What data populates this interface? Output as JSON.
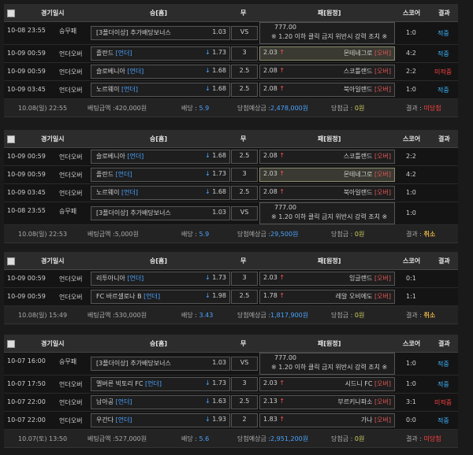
{
  "header": {
    "col_date": "경기일시",
    "col_type": "",
    "col_home": "승[홈]",
    "col_draw": "무",
    "col_away": "패[원정]",
    "col_score": "스코어",
    "col_result": "결과"
  },
  "labels": {
    "bet_amount": "베팅금액 :",
    "odds": "배당 :",
    "expected": "당첨예상금 :",
    "won": "당첨금 :",
    "result": "결과 :"
  },
  "special_text_1": "777.00",
  "special_text_2": "※ 1.20 이하 클릭 금지 위반시 강력 조치 ※",
  "bonus_label": "[3폴더이상] 추가배당보너스",
  "blocks": [
    {
      "rows": [
        {
          "date": "10-08 23:55",
          "type": "승무패",
          "home": "[3폴더이상] 추가배당보너스",
          "hodd": "1.03",
          "draw": "VS",
          "away": "",
          "score": "1:0",
          "result": "적중",
          "special": true
        },
        {
          "date": "10-09 00:59",
          "type": "언더오버",
          "home": "졸란드 [언더]",
          "hodd": "1.73",
          "draw": "3",
          "aodd": "2.03",
          "away": "몬테네그로 [오버]",
          "score": "4:2",
          "result": "적중"
        },
        {
          "date": "10-09 00:59",
          "type": "언더오버",
          "home": "슬로베니아 [언더]",
          "hodd": "1.68",
          "draw": "2.5",
          "aodd": "2.08",
          "away": "스코틀랜드 [오버]",
          "score": "2:2",
          "result": "미적중"
        },
        {
          "date": "10-09 03:45",
          "type": "언더오버",
          "home": "노르웨이 [언더]",
          "hodd": "1.68",
          "draw": "2.5",
          "aodd": "2.08",
          "away": "북아일랜드 [오버]",
          "score": "1:0",
          "result": "적중"
        }
      ],
      "foot": {
        "date": "10.08(일) 22:55",
        "bet": "420,000원",
        "odds": "5.9",
        "expected": "2,478,000원",
        "won": "0원",
        "result": "미당첨"
      }
    },
    {
      "rows": [
        {
          "date": "10-09 00:59",
          "type": "언더오버",
          "home": "슬로베니아 [언더]",
          "hodd": "1.68",
          "draw": "2.5",
          "aodd": "2.08",
          "away": "스코틀랜드 [오버]",
          "score": "2:2",
          "result": ""
        },
        {
          "date": "10-09 00:59",
          "type": "언더오버",
          "home": "졸란드 [언더]",
          "hodd": "1.73",
          "draw": "3",
          "aodd": "2.03",
          "away": "몬테네그로 [오버]",
          "score": "4:2",
          "result": ""
        },
        {
          "date": "10-09 03:45",
          "type": "언더오버",
          "home": "노르웨이 [언더]",
          "hodd": "1.68",
          "draw": "2.5",
          "aodd": "2.08",
          "away": "북아일랜드 [오버]",
          "score": "1:0",
          "result": ""
        },
        {
          "date": "10-08 23:55",
          "type": "승무패",
          "home": "[3폴더이상] 추가배당보너스",
          "hodd": "1.03",
          "draw": "VS",
          "away": "",
          "score": "1:0",
          "result": "",
          "special": true
        }
      ],
      "foot": {
        "date": "10.08(일) 22:53",
        "bet": "5,000원",
        "odds": "5.9",
        "expected": "29,500원",
        "won": "0원",
        "result": "취소"
      }
    },
    {
      "rows": [
        {
          "date": "10-09 00:59",
          "type": "언더오버",
          "home": "리투아니아 [언더]",
          "hodd": "1.73",
          "draw": "3",
          "aodd": "2.03",
          "away": "잉글랜드 [오버]",
          "score": "0:1",
          "result": ""
        },
        {
          "date": "10-09 00:59",
          "type": "언더오버",
          "home": "FC 바르셀로나 B [언더]",
          "hodd": "1.98",
          "draw": "2.5",
          "aodd": "1.78",
          "away": "레알 오비에도 [오버]",
          "score": "1:1",
          "result": ""
        }
      ],
      "foot": {
        "date": "10.08(일) 15:49",
        "bet": "530,000원",
        "odds": "3.43",
        "expected": "1,817,900원",
        "won": "0원",
        "result": "취소"
      }
    },
    {
      "rows": [
        {
          "date": "10-07 16:00",
          "type": "승무패",
          "home": "[3폴더이상] 추가배당보너스",
          "hodd": "1.03",
          "draw": "VS",
          "away": "",
          "score": "1:0",
          "result": "적중",
          "special": true
        },
        {
          "date": "10-07 17:50",
          "type": "언더오버",
          "home": "멜버른 빅토리 FC [언더]",
          "hodd": "1.73",
          "draw": "3",
          "aodd": "2.03",
          "away": "시드니 FC [오버]",
          "score": "1:0",
          "result": "적중"
        },
        {
          "date": "10-07 22:00",
          "type": "언더오버",
          "home": "남아공 [언더]",
          "hodd": "1.63",
          "draw": "2.5",
          "aodd": "2.13",
          "away": "부르키나파소 [오버]",
          "score": "3:1",
          "result": "미적중"
        },
        {
          "date": "10-07 22:00",
          "type": "언더오버",
          "home": "우간다 [언더]",
          "hodd": "1.93",
          "draw": "2",
          "aodd": "1.83",
          "away": "가나 [오버]",
          "score": "0:0",
          "result": "적중"
        }
      ],
      "foot": {
        "date": "10.07(토) 13:50",
        "bet": "527,000원",
        "odds": "5.6",
        "expected": "2,951,200원",
        "won": "0원",
        "result": "미당첨"
      }
    }
  ]
}
